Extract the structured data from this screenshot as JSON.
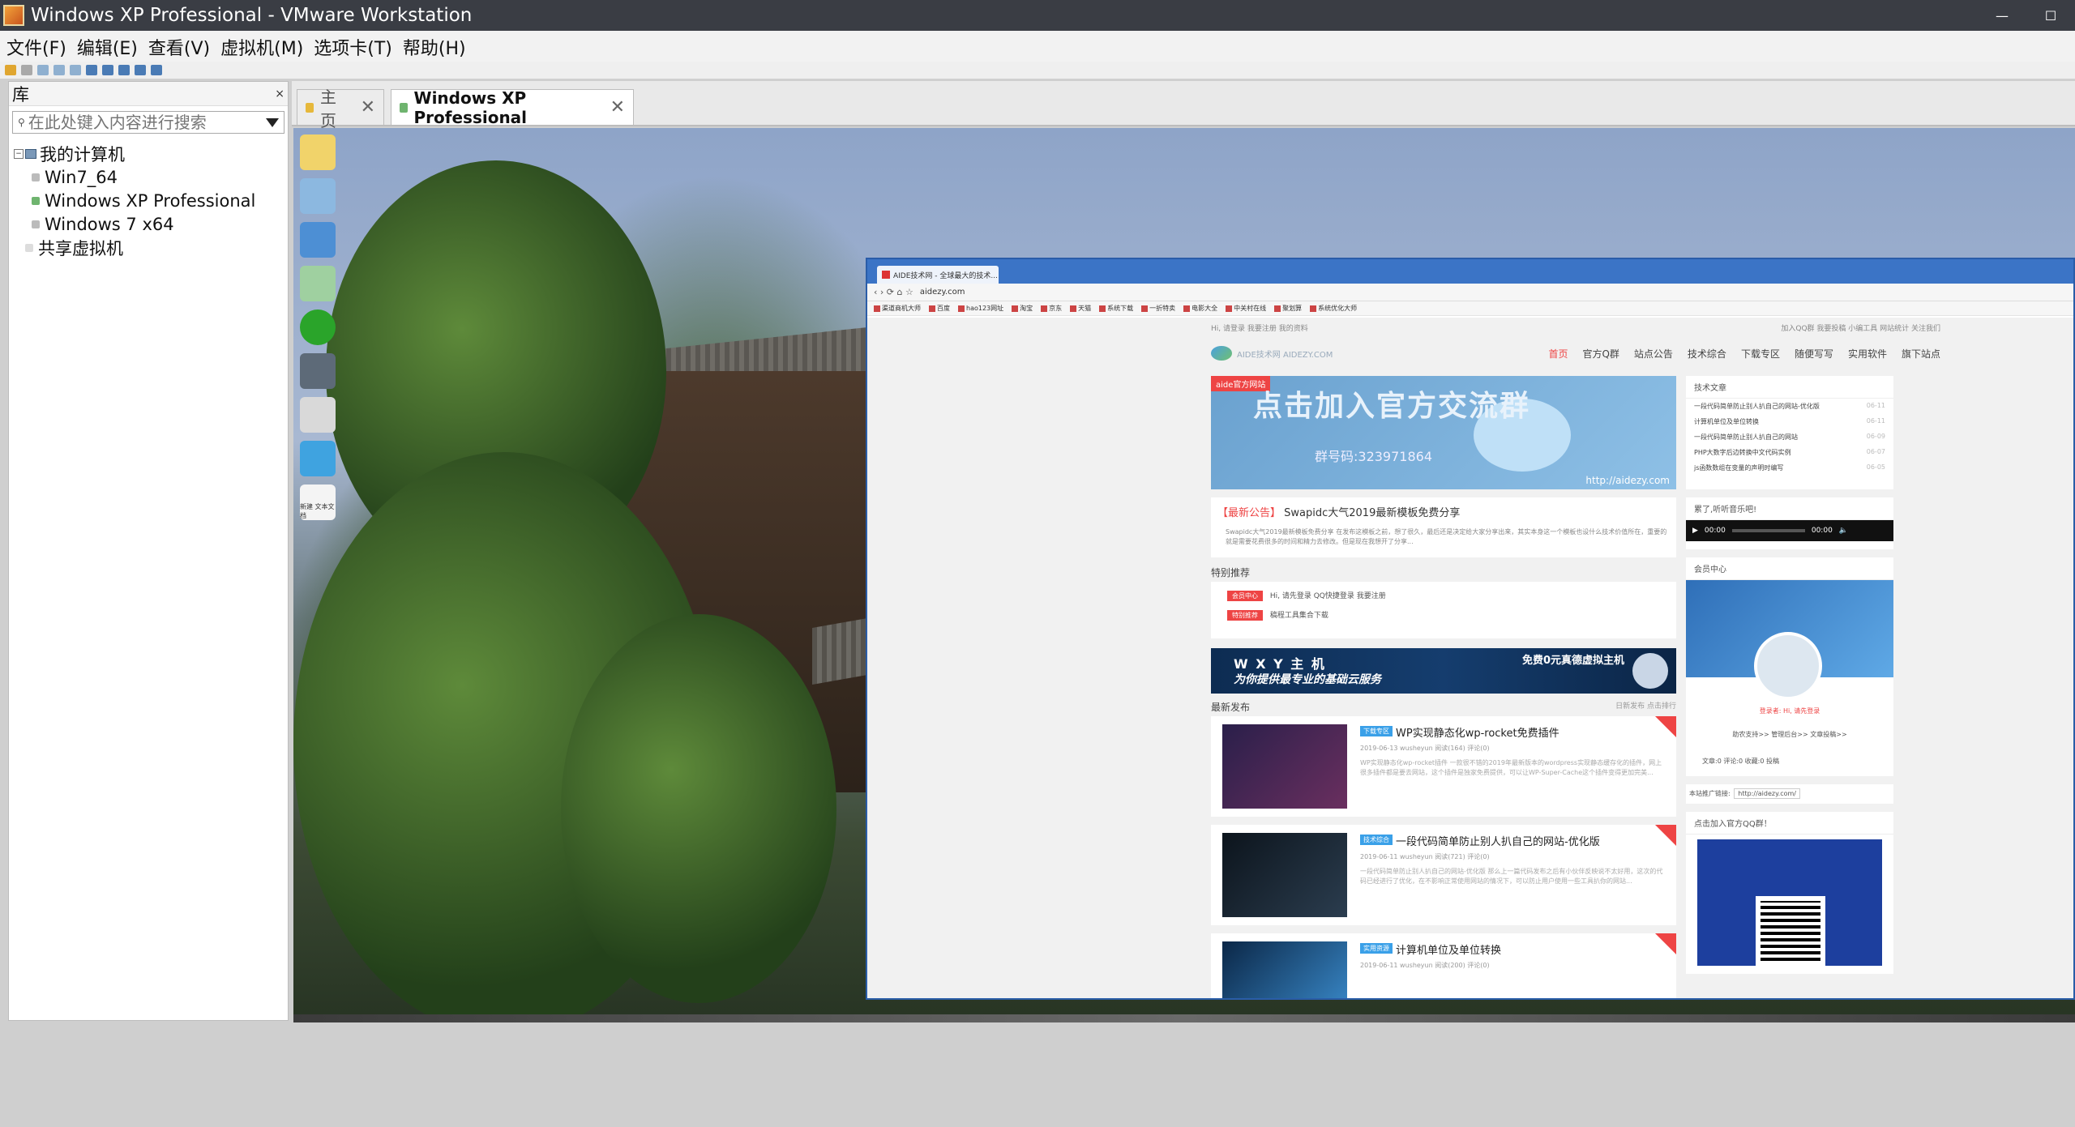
{
  "window": {
    "title": "Windows XP Professional - VMware Workstation"
  },
  "menu": [
    "文件(F)",
    "编辑(E)",
    "查看(V)",
    "虚拟机(M)",
    "选项卡(T)",
    "帮助(H)"
  ],
  "library": {
    "title": "库",
    "close": "×",
    "search_placeholder": "在此处键入内容进行搜索",
    "tree": {
      "root": "我的计算机",
      "vms": [
        "Win7_64",
        "Windows XP Professional",
        "Windows 7 x64"
      ],
      "shared": "共享虚拟机"
    }
  },
  "tabs": [
    {
      "label": "主页"
    },
    {
      "label": "Windows XP Professional"
    }
  ],
  "guest": {
    "desktop_icons": [
      "",
      "",
      "",
      "",
      "",
      "",
      "",
      "",
      "新建 文本文档"
    ],
    "browser": {
      "tab_title": "AIDE技术网 - 全球最大的技术...",
      "url": "aidezy.com",
      "bookmarks": [
        "渠道商机大师",
        "百度",
        "hao123网址",
        "淘宝",
        "京东",
        "天猫",
        "系统下载",
        "一折特卖",
        "电影大全",
        "中关村在线",
        "聚划算",
        "系统优化大师"
      ],
      "site": {
        "topline_left": "Hi, 请登录  我要注册  我的资料",
        "topline_right": "加入QQ群  我要投稿  小编工具  网站统计  关注我们",
        "logo_text": "AIDE技术网 AIDEZY.COM",
        "nav": [
          "首页",
          "官方Q群",
          "站点公告",
          "技术综合",
          "下载专区",
          "随便写写",
          "实用软件",
          "旗下站点"
        ],
        "banner": {
          "ribbon": "aide官方网站",
          "headline": "点击加入官方交流群",
          "qq": "群号码:323971864",
          "url": "http://aidezy.com"
        },
        "notice": {
          "label": "【最新公告】",
          "title": "Swapidc大气2019最新模板免费分享",
          "desc": "Swapidc大气2019最新模板免费分享  在发布这模板之前，想了很久，最后还是决定给大家分享出来，其实本身这一个模板也设什么技术价值所在，重要的就是需要花费很多的时间和精力去修改。但是现在我想开了分享..."
        },
        "featured_title": "特别推荐",
        "featured": [
          {
            "tag": "会员中心",
            "text": "Hi, 请先登录 QQ快捷登录 我要注册"
          },
          {
            "tag": "特别推荐",
            "text": "稿程工具集合下载"
          }
        ],
        "ad": {
          "line1": "W X Y 主 机",
          "line2": "为你提供最专业的基础云服务",
          "line3": "免费0元真德虚拟主机"
        },
        "latest_title": "最新发布",
        "latest_right": "日新发布  点击排行",
        "posts": [
          {
            "cat": "下载专区",
            "title": "WP实现静态化wp-rocket免费插件",
            "meta": "2019-06-13  wusheyun  阅读(164)  评论(0)",
            "excerpt": "WP实现静态化wp-rocket插件  一款很不错的2019年最新版本的wordpress实现静态缓存化的插件，网上很多插件都是要去网站，这个插件是独家免费提供，可以让WP-Super-Cache这个插件变得更加完美..."
          },
          {
            "cat": "技术综合",
            "title": "一段代码简单防止别人扒自己的网站-优化版",
            "meta": "2019-06-11  wusheyun  阅读(721)  评论(0)",
            "excerpt": "一段代码简单防止别人扒自己的网站-优化版  那么上一篇代码发布之后有小伙伴反映说不太好用，这次的代码已经进行了优化，在不影响正常使用网站的情况下，可以防止用户使用一些工具扒你的网站..."
          },
          {
            "cat": "实用资源",
            "title": "计算机单位及单位转换",
            "meta": "2019-06-11  wusheyun  阅读(200)  评论(0)",
            "excerpt": ""
          }
        ],
        "sidebar": {
          "tech_title": "技术文章",
          "tech_items": [
            {
              "t": "一段代码简单防止别人扒自己的网站-优化版",
              "d": "06-11"
            },
            {
              "t": "计算机单位及单位转换",
              "d": "06-11"
            },
            {
              "t": "一段代码简单防止别人扒自己的网站",
              "d": "06-09"
            },
            {
              "t": "PHP大数字后边转换中文代码实例",
              "d": "06-07"
            },
            {
              "t": "js函数数组在变量的声明时编写",
              "d": "06-05"
            }
          ],
          "music_title": "累了,听听音乐吧!",
          "player_time": "00:00",
          "member_title": "会员中心",
          "member_login": "登录者: Hi, 请先登录",
          "member_links": "助农支持>>  管理后台>>  文章投稿>>",
          "member_stats": "文章:0  评论:0  收藏:0  投稿",
          "promo_label": "本站推广链接:",
          "promo_url": "http://aidezy.com/",
          "qq_title": "点击加入官方QQ群！"
        }
      }
    }
  }
}
